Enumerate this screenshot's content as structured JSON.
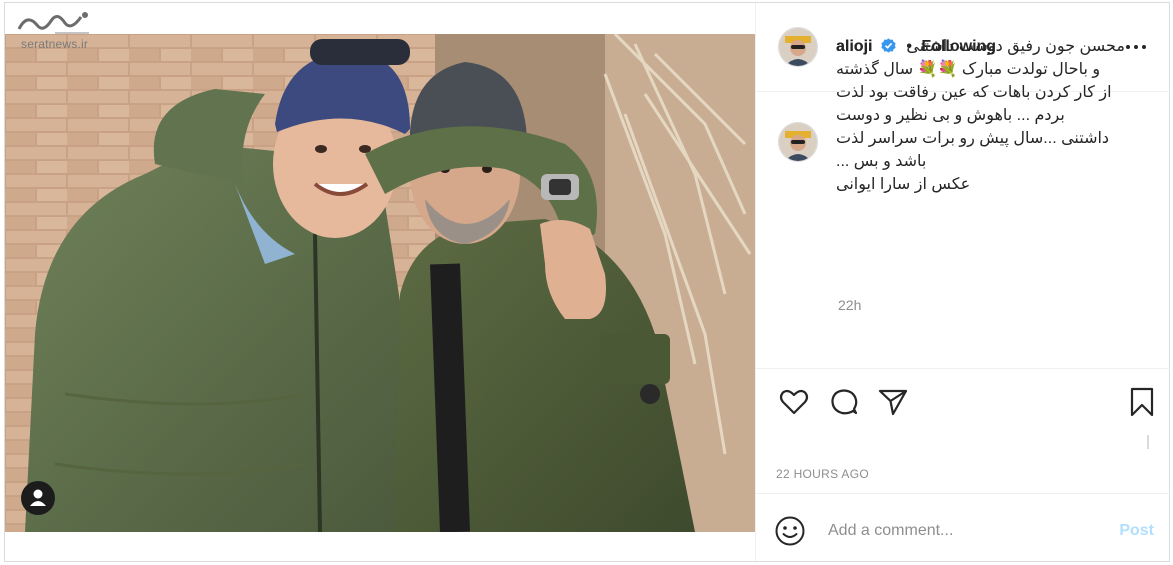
{
  "watermark": {
    "site": "seratnews.ir"
  },
  "account": {
    "username": "alioji",
    "verified": true
  },
  "header": {
    "separator": "•",
    "follow_status": "Following",
    "more_icon": "more-options-icon"
  },
  "caption": {
    "username": "alioji",
    "lines": [
      "محسن جون رفیق دوست داشتنی",
      "و باحال تولدت مبارک 💐💐 سال گذشته",
      "از کار کردن باهات که عین رفاقت بود لذت",
      "بردم ... باهوش و بی نظیر و دوست",
      "داشتنی ...سال پیش رو برات سراسر لذت",
      "باشد و بس ...",
      "عکس از سارا ایوانی"
    ],
    "time_ago": "22h"
  },
  "actions": {
    "like_icon": "heart-icon",
    "comment_icon": "comment-bubble-icon",
    "share_icon": "paper-plane-icon",
    "save_icon": "bookmark-icon"
  },
  "post_date": "22 HOURS AGO",
  "comment": {
    "placeholder": "Add a comment...",
    "post_label": "Post",
    "emoji_icon": "emoji-smile-icon"
  },
  "colors": {
    "verified_blue": "#3897f0",
    "post_button_disabled": "#b2dffc",
    "meta_gray": "#8e8e8e",
    "border": "#dbdbdb"
  }
}
